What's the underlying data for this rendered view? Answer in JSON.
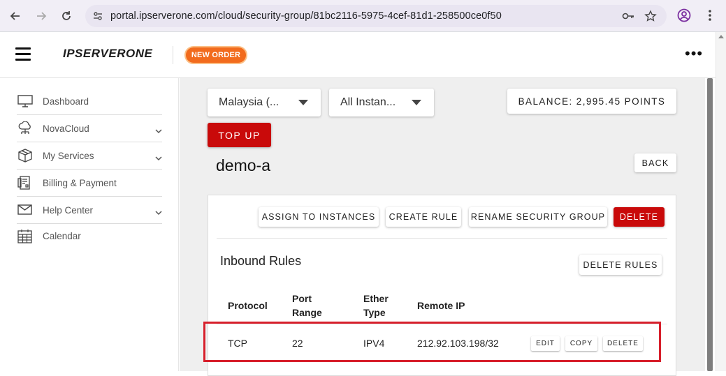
{
  "browser": {
    "url": "portal.ipserverone.com/cloud/security-group/81bc2116-5975-4cef-81d1-258500ce0f50"
  },
  "header": {
    "logo_text": "IPSERVERONE",
    "new_order_label": "NEW ORDER",
    "more_label": "•••"
  },
  "sidebar": {
    "items": [
      {
        "label": "Dashboard",
        "icon": "monitor-icon",
        "has_children": false
      },
      {
        "label": "NovaCloud",
        "icon": "cloud-network-icon",
        "has_children": true
      },
      {
        "label": "My Services",
        "icon": "box-icon",
        "has_children": true
      },
      {
        "label": "Billing & Payment",
        "icon": "receipt-icon",
        "has_children": false
      },
      {
        "label": "Help Center",
        "icon": "mail-icon",
        "has_children": true
      },
      {
        "label": "Calendar",
        "icon": "calendar-icon",
        "has_children": false
      }
    ]
  },
  "toolbar": {
    "region_select": "Malaysia (...",
    "instance_select": "All Instan...",
    "balance_label": "BALANCE: 2,995.45 POINTS",
    "topup_label": "TOP UP"
  },
  "page": {
    "title": "demo-a",
    "back_label": "BACK"
  },
  "actions": {
    "assign_label": "ASSIGN TO INSTANCES",
    "create_rule_label": "CREATE RULE",
    "rename_label": "RENAME SECURITY GROUP",
    "delete_label": "DELETE"
  },
  "inbound": {
    "title": "Inbound Rules",
    "delete_rules_label": "DELETE RULES",
    "columns": {
      "protocol": "Protocol",
      "port_range_1": "Port",
      "port_range_2": "Range",
      "ether_type_1": "Ether",
      "ether_type_2": "Type",
      "remote_ip": "Remote IP"
    },
    "rows": [
      {
        "protocol": "TCP",
        "port_range": "22",
        "ether_type": "IPV4",
        "remote_ip": "212.92.103.198/32",
        "edit_label": "EDIT",
        "copy_label": "COPY",
        "delete_label": "DELETE"
      }
    ]
  },
  "colors": {
    "brand_red": "#c90a0a",
    "new_order_orange": "#f26b1d",
    "highlight_red": "#d71f2b"
  }
}
